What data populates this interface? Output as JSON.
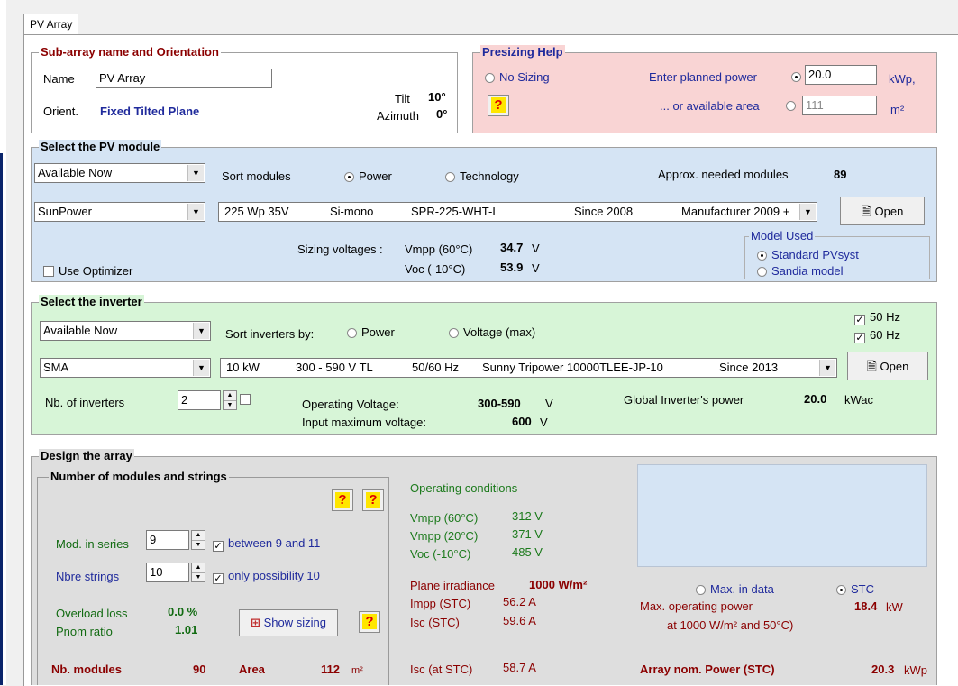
{
  "tab": {
    "label": "PV Array"
  },
  "subarray": {
    "title": "Sub-array name and Orientation",
    "name_label": "Name",
    "name_value": "PV Array",
    "orient_label": "Orient.",
    "orient_value": "Fixed Tilted Plane",
    "tilt_label": "Tilt",
    "tilt_value": "10°",
    "azimuth_label": "Azimuth",
    "azimuth_value": "0°"
  },
  "presizing": {
    "title": "Presizing Help",
    "no_sizing": "No Sizing",
    "planned_power_label": "Enter planned power",
    "planned_power_value": "20.0",
    "planned_power_unit": "kWp,",
    "area_label": "... or available area",
    "area_value": "111",
    "area_unit": "m²",
    "help": "?"
  },
  "module": {
    "title": "Select the PV module",
    "availability": "Available Now",
    "sort_label": "Sort modules",
    "sort_power": "Power",
    "sort_technology": "Technology",
    "needed_label": "Approx. needed modules",
    "needed_value": "89",
    "manufacturer": "SunPower",
    "model_power": "225 Wp 35V",
    "model_tech": "Si-mono",
    "model_name": "SPR-225-WHT-I",
    "model_since": "Since 2008",
    "model_source": "Manufacturer 2009 +",
    "open_label": "Open",
    "sizing_label": "Sizing voltages :",
    "vmpp_label": "Vmpp (60°C)",
    "vmpp_value": "34.7",
    "voc_label": "Voc  (-10°C)",
    "voc_value": "53.9",
    "volt_unit": "V",
    "use_optimizer": "Use Optimizer",
    "model_used_title": "Model Used",
    "model_standard": "Standard PVsyst",
    "model_sandia": "Sandia model"
  },
  "inverter": {
    "title": "Select the inverter",
    "availability": "Available Now",
    "sort_label": "Sort inverters by:",
    "sort_power": "Power",
    "sort_voltage": "Voltage (max)",
    "hz50": "50 Hz",
    "hz60": "60 Hz",
    "manufacturer": "SMA",
    "model_power": "10 kW",
    "model_range": "300 - 590 V  TL",
    "model_freq": "50/60 Hz",
    "model_name": "Sunny Tripower 10000TLEE-JP-10",
    "model_since": "Since 2013",
    "open_label": "Open",
    "nb_label": "Nb. of inverters",
    "nb_value": "2",
    "op_voltage_label": "Operating Voltage:",
    "op_voltage_value": "300-590",
    "input_max_label": "Input maximum voltage:",
    "input_max_value": "600",
    "volt_unit": "V",
    "global_power_label": "Global Inverter's power",
    "global_power_value": "20.0",
    "global_power_unit": "kWac"
  },
  "design": {
    "title": "Design the array",
    "strings_title": "Number of modules and strings",
    "help": "?",
    "mod_series_label": "Mod. in series",
    "mod_series_value": "9",
    "mod_series_check": "between 9 and 11",
    "nb_strings_label": "Nbre strings",
    "nb_strings_value": "10",
    "nb_strings_check": "only possibility 10",
    "overload_label": "Overload loss",
    "overload_value": "0.0 %",
    "pnom_label": "Pnom ratio",
    "pnom_value": "1.01",
    "show_sizing": "Show sizing",
    "nb_modules_label": "Nb. modules",
    "nb_modules_value": "90",
    "area_label": "Area",
    "area_value": "112",
    "area_unit": "m²",
    "op_cond_title": "Operating conditions",
    "vmpp60_label": "Vmpp (60°C)",
    "vmpp60_value": "312 V",
    "vmpp20_label": "Vmpp (20°C)",
    "vmpp20_value": "371 V",
    "voc_label": "Voc  (-10°C)",
    "voc_value": "485 V",
    "irradiance_label": "Plane irradiance",
    "irradiance_value": "1000 W/m²",
    "impp_label": "Impp (STC)",
    "impp_value": "56.2 A",
    "isc_label": "Isc  (STC)",
    "isc_value": "59.6 A",
    "isc_at_label": "Isc (at STC)",
    "isc_at_value": "58.7 A",
    "max_in_data": "Max. in data",
    "stc": "STC",
    "max_op_power_label": "Max. operating power",
    "max_op_power_sub": "at 1000 W/m² and 50°C)",
    "max_op_power_value": "18.4",
    "max_op_power_unit": "kW",
    "array_nom_label": "Array nom. Power (STC)",
    "array_nom_value": "20.3",
    "array_nom_unit": "kWp"
  }
}
